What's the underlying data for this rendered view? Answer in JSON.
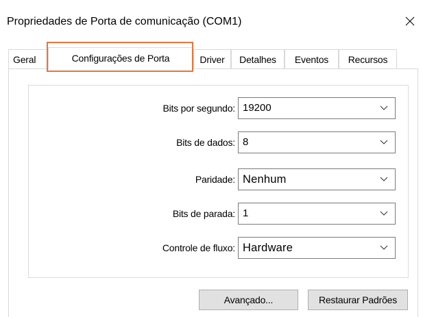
{
  "window": {
    "title": "Propriedades de Porta de comunicação (COM1)"
  },
  "tabs": [
    {
      "label": "Geral"
    },
    {
      "label": "Configurações de Porta"
    },
    {
      "label": "Driver"
    },
    {
      "label": "Detalhes"
    },
    {
      "label": "Eventos"
    },
    {
      "label": "Recursos"
    }
  ],
  "active_tab": "Configurações de Porta",
  "fields": [
    {
      "label": "Bits por segundo:",
      "value": "19200"
    },
    {
      "label": "Bits de dados:",
      "value": "8"
    },
    {
      "label": "Paridade:",
      "value": "Nenhum"
    },
    {
      "label": "Bits de parada:",
      "value": "1"
    },
    {
      "label": "Controle de fluxo:",
      "value": "Hardware"
    }
  ],
  "buttons": {
    "advanced": "Avançado...",
    "restore_defaults": "Restaurar Padrões"
  },
  "colors": {
    "highlight": "#e9733a",
    "border": "#d9d9d9",
    "button_bg": "#e1e1e1"
  },
  "icons": {
    "close": "close-icon",
    "dropdown": "chevron-down-icon"
  }
}
